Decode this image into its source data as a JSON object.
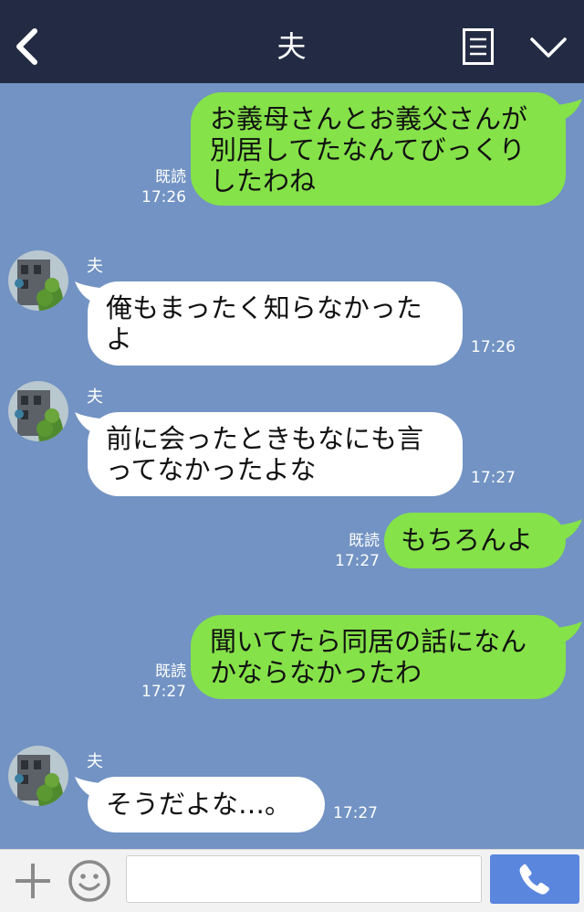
{
  "header": {
    "title": "夫"
  },
  "messages": [
    {
      "from": "me",
      "text": "お義母さんとお義父さんが\n別居してたなんてびっくり\nしたわね",
      "read": "既読",
      "time": "17:26"
    },
    {
      "from": "them",
      "sender": "夫",
      "text": "俺もまったく知らなかった\nよ",
      "time": "17:26"
    },
    {
      "from": "them",
      "sender": "夫",
      "text": "前に会ったときもなにも言\nってなかったよな",
      "time": "17:27"
    },
    {
      "from": "me",
      "text": "もちろんよ",
      "read": "既読",
      "time": "17:27"
    },
    {
      "from": "me",
      "text": "聞いてたら同居の話になん\nかならなかったわ",
      "read": "既読",
      "time": "17:27"
    },
    {
      "from": "them",
      "sender": "夫",
      "text": "そうだよな…。",
      "time": "17:27"
    }
  ],
  "footer": {
    "input_value": ""
  },
  "colors": {
    "header": "#232b44",
    "background": "#7293c3",
    "me_bubble": "#85e249",
    "them_bubble": "#ffffff",
    "send": "#5a86de"
  },
  "icons": {
    "back": "chevron-left-icon",
    "menu": "menu-icon",
    "dropdown": "chevron-down-icon",
    "plus": "plus-icon",
    "emoji": "smile-icon",
    "call": "phone-icon"
  }
}
